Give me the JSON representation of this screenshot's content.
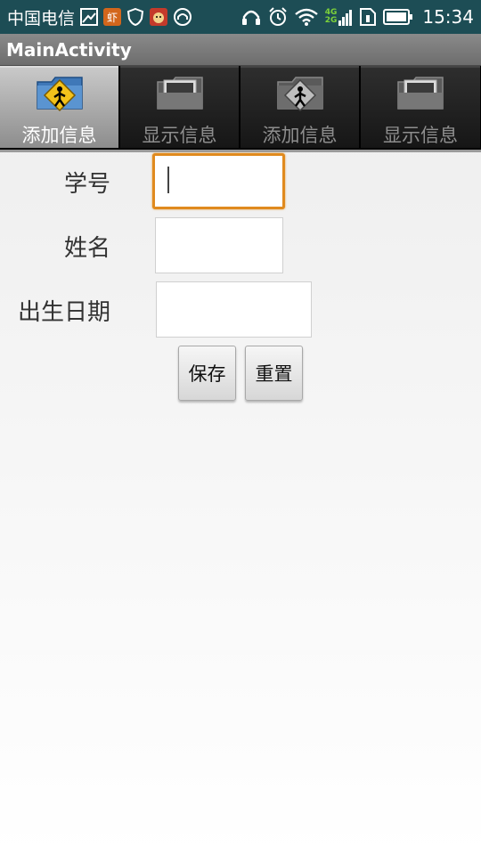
{
  "status_bar": {
    "carrier": "中国电信",
    "network_label_top": "4G",
    "network_label_bottom": "2G",
    "time": "15:34",
    "icons_left": [
      "gallery-icon",
      "app-notification-icon",
      "shield-icon",
      "game-icon",
      "headset-icon"
    ],
    "icons_right": [
      "headphones-icon",
      "alarm-icon",
      "wifi-icon",
      "signal-icon",
      "sim-icon",
      "battery-icon"
    ]
  },
  "app": {
    "title": "MainActivity"
  },
  "tabs": [
    {
      "label": "添加信息",
      "icon": "add-person-folder-icon",
      "selected": true
    },
    {
      "label": "显示信息",
      "icon": "photo-folder-icon",
      "selected": false
    },
    {
      "label": "添加信息",
      "icon": "add-person-folder-icon",
      "selected": false
    },
    {
      "label": "显示信息",
      "icon": "photo-folder-icon",
      "selected": false
    }
  ],
  "form": {
    "student_id": {
      "label": "学号",
      "value": ""
    },
    "name": {
      "label": "姓名",
      "value": ""
    },
    "birthdate": {
      "label": "出生日期",
      "value": ""
    }
  },
  "buttons": {
    "save": "保存",
    "reset": "重置"
  },
  "colors": {
    "status_bar": "#1d4d55",
    "focus_border": "#e08a1e",
    "tab_selected": "#b3b3b3"
  }
}
